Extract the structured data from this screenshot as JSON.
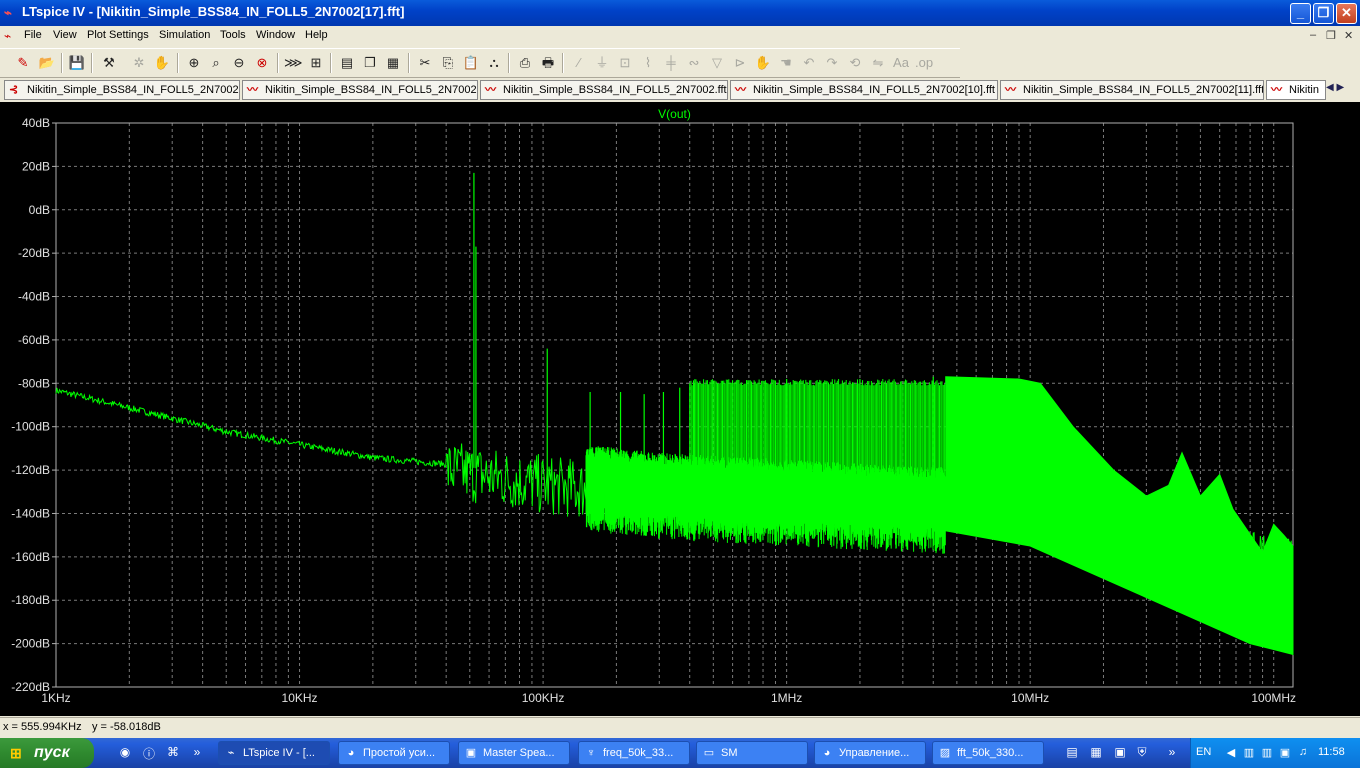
{
  "window": {
    "title": "LTspice IV - [Nikitin_Simple_BSS84_IN_FOLL5_2N7002[17].fft]",
    "controls": {
      "minimize": "_",
      "restore": "❐",
      "close": "✕"
    }
  },
  "menu": [
    "File",
    "View",
    "Plot Settings",
    "Simulation",
    "Tools",
    "Window",
    "Help"
  ],
  "mdi_controls": [
    "–",
    "❐",
    "✕"
  ],
  "tabs": [
    {
      "label": "Nikitin_Simple_BSS84_IN_FOLL5_2N7002",
      "icon": "schematic-icon"
    },
    {
      "label": "Nikitin_Simple_BSS84_IN_FOLL5_2N7002",
      "icon": "waveform-icon"
    },
    {
      "label": "Nikitin_Simple_BSS84_IN_FOLL5_2N7002.fft",
      "icon": "waveform-icon"
    },
    {
      "label": "Nikitin_Simple_BSS84_IN_FOLL5_2N7002[10].fft",
      "icon": "waveform-icon"
    },
    {
      "label": "Nikitin_Simple_BSS84_IN_FOLL5_2N7002[11].fft",
      "icon": "waveform-icon"
    },
    {
      "label": "Nikitin",
      "icon": "waveform-icon"
    }
  ],
  "chart_data": {
    "type": "line",
    "title": "V(out)",
    "x_scale": "log",
    "xlim_hz": [
      1000,
      120000000
    ],
    "ylim_db": [
      -220,
      40
    ],
    "x_ticks": [
      "1KHz",
      "10KHz",
      "100KHz",
      "1MHz",
      "10MHz",
      "100MHz"
    ],
    "y_ticks": [
      "40dB",
      "20dB",
      "0dB",
      "-20dB",
      "-40dB",
      "-60dB",
      "-80dB",
      "-100dB",
      "-120dB",
      "-140dB",
      "-160dB",
      "-180dB",
      "-200dB",
      "-220dB"
    ],
    "grid": true,
    "series": [
      {
        "name": "V(out)",
        "color": "#00ff00",
        "trend": [
          {
            "x": 1000,
            "y": -83
          },
          {
            "x": 2000,
            "y": -91
          },
          {
            "x": 5000,
            "y": -102
          },
          {
            "x": 10000,
            "y": -108
          },
          {
            "x": 20000,
            "y": -114
          },
          {
            "x": 40000,
            "y": -117
          },
          {
            "x": 100000,
            "y": -124
          },
          {
            "x": 300000,
            "y": -130
          },
          {
            "x": 1000000,
            "y": -133
          },
          {
            "x": 3000000,
            "y": -136
          },
          {
            "x": 10000000,
            "y": -138
          },
          {
            "x": 30000000,
            "y": -148
          },
          {
            "x": 100000000,
            "y": -158
          },
          {
            "x": 120000000,
            "y": -160
          }
        ],
        "spikes": [
          {
            "x": 52000,
            "y": 17
          },
          {
            "x": 53000,
            "y": -17
          },
          {
            "x": 104000,
            "y": -64
          },
          {
            "x": 156000,
            "y": -84
          },
          {
            "x": 208000,
            "y": -84
          },
          {
            "x": 260000,
            "y": -85
          },
          {
            "x": 312000,
            "y": -84
          },
          {
            "x": 364000,
            "y": -82
          },
          {
            "x": 416000,
            "y": -80
          },
          {
            "x": 520000,
            "y": -80
          },
          {
            "x": 1000000,
            "y": -78
          },
          {
            "x": 2000000,
            "y": -78
          },
          {
            "x": 4000000,
            "y": -77
          }
        ],
        "envelope_top": [
          {
            "x": 4500000,
            "y": -77
          },
          {
            "x": 9000000,
            "y": -78
          },
          {
            "x": 11000000,
            "y": -80
          },
          {
            "x": 15000000,
            "y": -100
          },
          {
            "x": 22000000,
            "y": -120
          },
          {
            "x": 30000000,
            "y": -132
          },
          {
            "x": 37000000,
            "y": -127
          },
          {
            "x": 42000000,
            "y": -112
          },
          {
            "x": 50000000,
            "y": -132
          },
          {
            "x": 60000000,
            "y": -122
          },
          {
            "x": 68000000,
            "y": -138
          },
          {
            "x": 90000000,
            "y": -158
          },
          {
            "x": 100000000,
            "y": -145
          },
          {
            "x": 110000000,
            "y": -150
          },
          {
            "x": 120000000,
            "y": -155
          }
        ],
        "envelope_bottom": [
          {
            "x": 4500000,
            "y": -148
          },
          {
            "x": 10000000,
            "y": -155
          },
          {
            "x": 20000000,
            "y": -170
          },
          {
            "x": 40000000,
            "y": -185
          },
          {
            "x": 80000000,
            "y": -200
          },
          {
            "x": 120000000,
            "y": -205
          }
        ]
      }
    ]
  },
  "status": {
    "x": "x = 555.994KHz",
    "y": "y = -58.018dB"
  },
  "taskbar": {
    "start_label": "пуск",
    "tasks": [
      {
        "label": "LTspice IV - [...",
        "icon": "ltspice-icon",
        "active": true
      },
      {
        "label": "Простой уси...",
        "icon": "firefox-icon",
        "active": false
      },
      {
        "label": "Master Spea...",
        "icon": "window-icon",
        "active": false
      },
      {
        "label": "freq_50k_33...",
        "icon": "file-icon",
        "active": false
      },
      {
        "label": "SM",
        "icon": "folder-icon",
        "active": false
      },
      {
        "label": "Управление...",
        "icon": "firefox-icon",
        "active": false
      },
      {
        "label": "fft_50k_330...",
        "icon": "image-icon",
        "active": false
      }
    ],
    "lang": "EN",
    "clock": "11:58"
  }
}
